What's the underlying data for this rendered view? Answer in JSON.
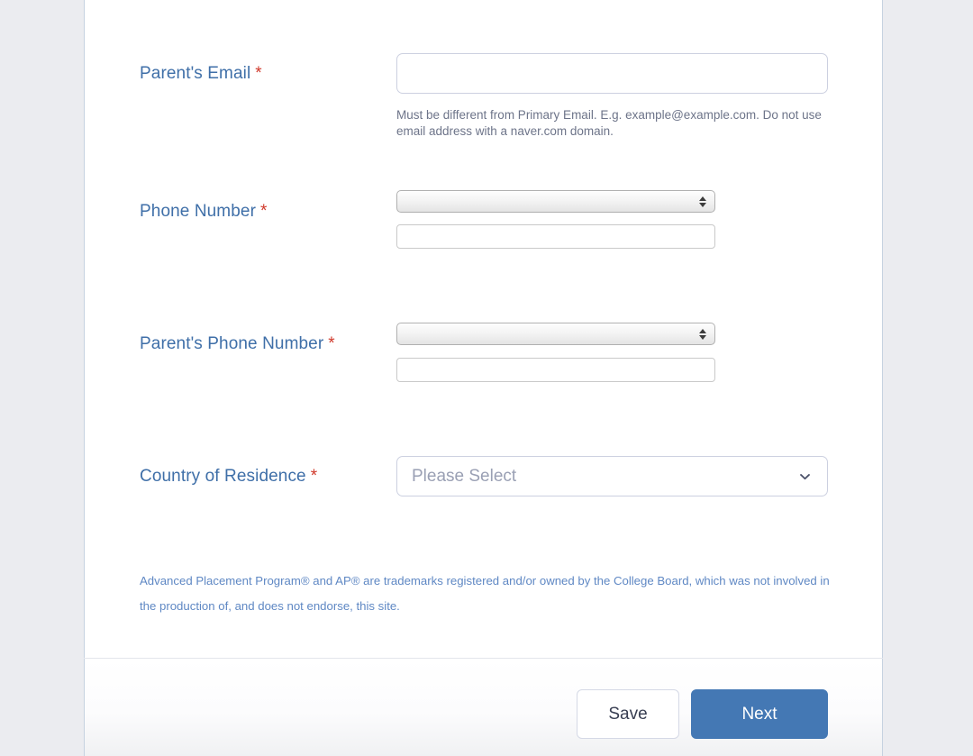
{
  "theme": {
    "page_background": "#ebecf0",
    "card_background": "#ffffff",
    "label_color": "#3f6fa8",
    "required_color": "#d0392b",
    "helper_color": "#6d7489",
    "footnote_color": "#5f88c4",
    "primary_button_color": "#4478b4",
    "secondary_button_text": "#383e52"
  },
  "form": {
    "required_marker": "*",
    "fields": [
      {
        "name": "parents-email",
        "label": "Parent's Email",
        "required": true,
        "type": "text",
        "value": "",
        "placeholder": "",
        "helper": "Must be different from Primary Email. E.g. example@example.com. Do not use email address with a naver.com domain."
      },
      {
        "name": "phone-number",
        "label": "Phone Number",
        "required": true,
        "type": "country-code-phone",
        "country_code_value": "",
        "number_value": "",
        "number_placeholder": ""
      },
      {
        "name": "parents-phone-number",
        "label": "Parent's Phone Number",
        "required": true,
        "type": "country-code-phone",
        "country_code_value": "",
        "number_value": "",
        "number_placeholder": ""
      },
      {
        "name": "country-of-residence",
        "label": "Country of Residence",
        "required": true,
        "type": "select",
        "selected": "Please Select",
        "chevron_icon": "chevron-down-icon"
      }
    ],
    "footnote": "Advanced Placement Program® and AP® are trademarks registered and/or owned by the College Board, which was not involved in the production of, and does not endorse, this site."
  },
  "footer": {
    "save_label": "Save",
    "next_label": "Next"
  }
}
